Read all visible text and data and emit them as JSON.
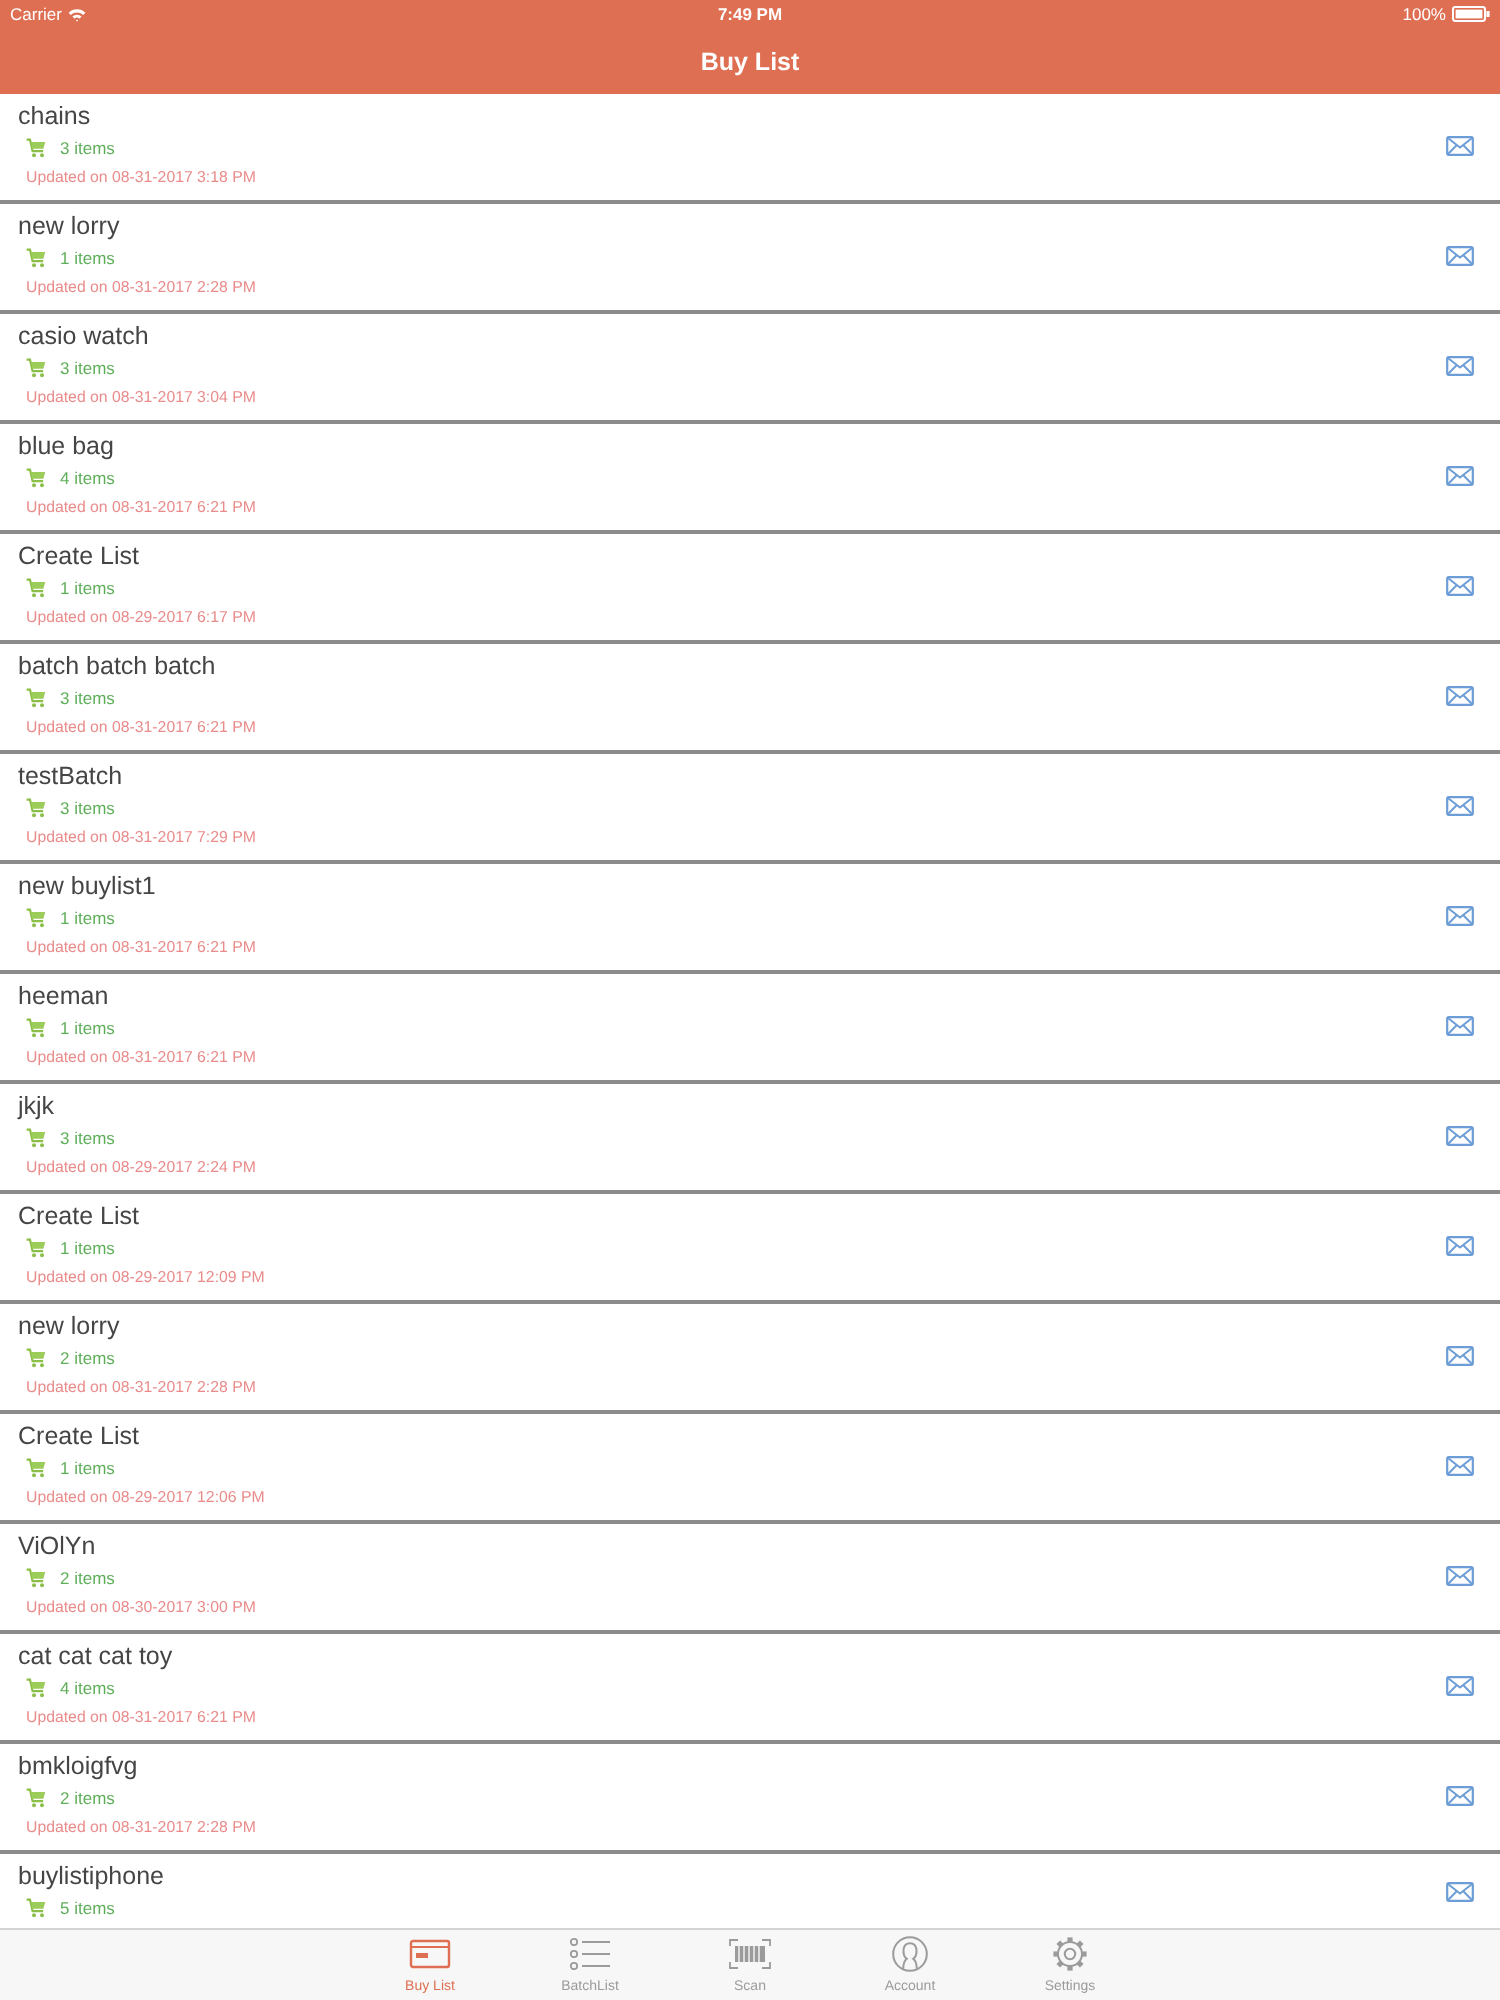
{
  "status_bar": {
    "carrier": "Carrier",
    "time": "7:49 PM",
    "battery": "100%"
  },
  "nav_bar": {
    "title": "Buy List"
  },
  "lists": [
    {
      "name": "chains",
      "count": "3 items",
      "updated": "Updated on 08-31-2017 3:18 PM"
    },
    {
      "name": "new lorry",
      "count": "1 items",
      "updated": "Updated on 08-31-2017 2:28 PM"
    },
    {
      "name": "casio watch",
      "count": "3 items",
      "updated": "Updated on 08-31-2017 3:04 PM"
    },
    {
      "name": "blue bag",
      "count": "4 items",
      "updated": "Updated on 08-31-2017 6:21 PM"
    },
    {
      "name": "Create List",
      "count": "1 items",
      "updated": "Updated on 08-29-2017 6:17 PM"
    },
    {
      "name": "batch batch batch",
      "count": "3 items",
      "updated": "Updated on 08-31-2017 6:21 PM"
    },
    {
      "name": "testBatch",
      "count": "3 items",
      "updated": "Updated on 08-31-2017 7:29 PM"
    },
    {
      "name": "new buylist1",
      "count": "1 items",
      "updated": "Updated on 08-31-2017 6:21 PM"
    },
    {
      "name": "heeman",
      "count": "1 items",
      "updated": "Updated on 08-31-2017 6:21 PM"
    },
    {
      "name": "jkjk",
      "count": "3 items",
      "updated": "Updated on 08-29-2017 2:24 PM"
    },
    {
      "name": "Create List",
      "count": "1 items",
      "updated": "Updated on 08-29-2017 12:09 PM"
    },
    {
      "name": "new lorry",
      "count": "2 items",
      "updated": "Updated on 08-31-2017 2:28 PM"
    },
    {
      "name": "Create List",
      "count": "1 items",
      "updated": "Updated on 08-29-2017 12:06 PM"
    },
    {
      "name": "ViOlYn",
      "count": "2 items",
      "updated": "Updated on 08-30-2017 3:00 PM"
    },
    {
      "name": "cat cat cat toy",
      "count": "4 items",
      "updated": "Updated on 08-31-2017 6:21 PM"
    },
    {
      "name": "bmkloigfvg",
      "count": "2 items",
      "updated": "Updated on 08-31-2017 2:28 PM"
    },
    {
      "name": "buylistiphone",
      "count": "5 items"
    }
  ],
  "tab_bar": [
    {
      "label": "Buy List",
      "selected": true
    },
    {
      "label": "BatchList",
      "selected": false
    },
    {
      "label": "Scan",
      "selected": false
    },
    {
      "label": "Account",
      "selected": false
    },
    {
      "label": "Settings",
      "selected": false
    }
  ]
}
